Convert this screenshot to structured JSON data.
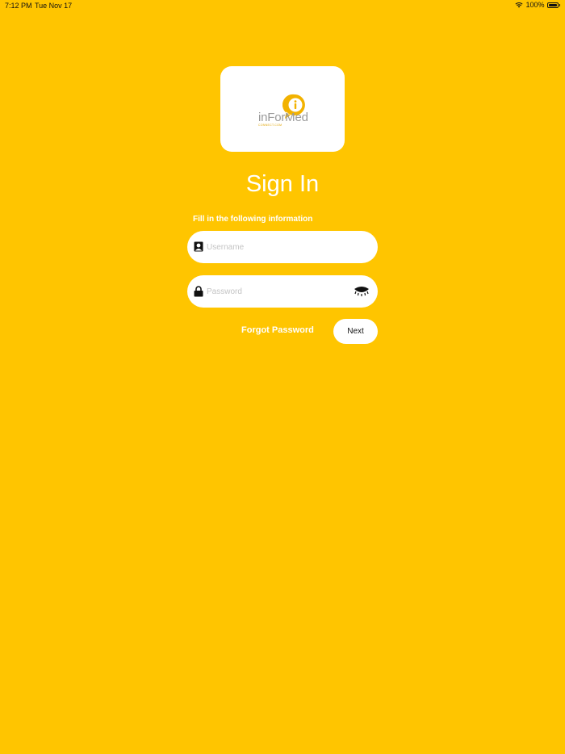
{
  "status_bar": {
    "time": "7:12 PM",
    "date": "Tue Nov 17",
    "battery": "100%",
    "wifi_icon": "wifi-icon",
    "battery_icon": "battery-icon"
  },
  "logo": {
    "brand_text": "inForMed",
    "brand_sub": "CONNECT.COM",
    "pin_icon": "info-pin-icon",
    "brand_color": "#F2B200"
  },
  "header": {
    "title": "Sign In",
    "subtitle": "Fill in the following information"
  },
  "form": {
    "username": {
      "value": "",
      "placeholder": "Username",
      "icon": "user-card-icon"
    },
    "password": {
      "value": "",
      "placeholder": "Password",
      "icon": "lock-icon",
      "toggle_icon": "eye-closed-icon"
    }
  },
  "actions": {
    "forgot_label": "Forgot Password",
    "next_label": "Next"
  },
  "colors": {
    "background": "#FFC500",
    "card": "#FFFFFF",
    "text_light": "#FFFFFF"
  }
}
